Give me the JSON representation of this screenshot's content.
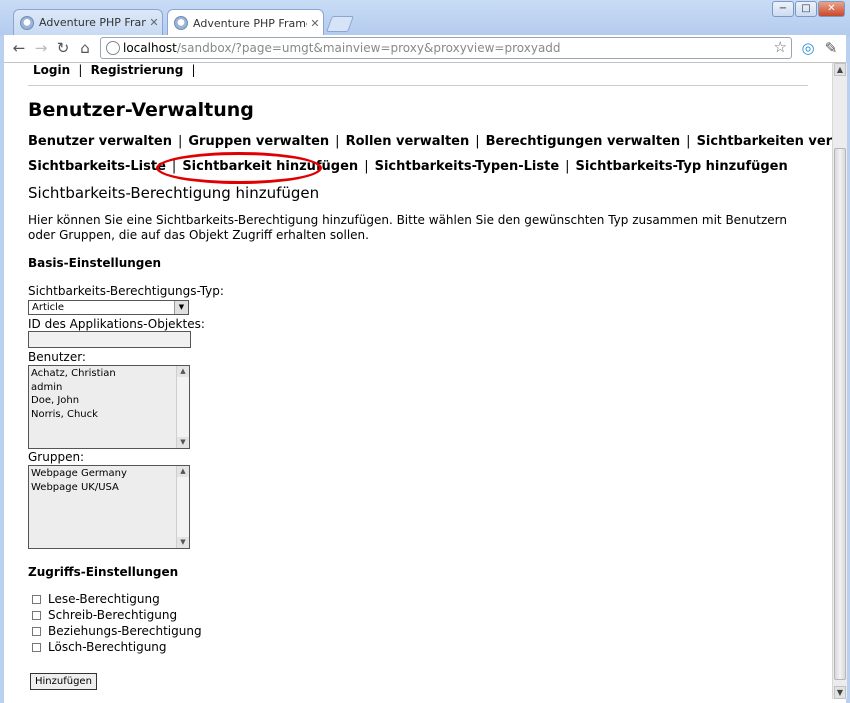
{
  "browser": {
    "tabs": [
      {
        "title": "Adventure PHP Framework sa",
        "active": false
      },
      {
        "title": "Adventure PHP Framework sa",
        "active": true
      }
    ],
    "window_buttons": {
      "minimize": "−",
      "maximize": "□",
      "close": "✕"
    },
    "url_host": "localhost",
    "url_path": "/sandbox/?page=umgt&mainview=proxy&proxyview=proxyadd"
  },
  "topnav": {
    "login": "Login",
    "register": "Registrierung",
    "separator": "|"
  },
  "page": {
    "title": "Benutzer-Verwaltung",
    "menu_row1": [
      "Benutzer verwalten",
      "Gruppen verwalten",
      "Rollen verwalten",
      "Berechtigungen verwalten",
      "Sichtbarkeiten verwalten"
    ],
    "menu_row2": [
      "Sichtbarkeits-Liste",
      "Sichtbarkeit hinzufügen",
      "Sichtbarkeits-Typen-Liste",
      "Sichtbarkeits-Typ hinzufügen"
    ],
    "menu_separator": "|",
    "subtitle": "Sichtbarkeits-Berechtigung hinzufügen",
    "intro": "Hier können Sie eine Sichtbarkeits-Berechtigung hinzufügen. Bitte wählen Sie den gewünschten Typ zusammen mit Benutzern oder Gruppen, die auf das Objekt Zugriff erhalten sollen.",
    "basic_section": "Basis-Einstellungen",
    "type_label": "Sichtbarkeits-Berechtigungs-Typ:",
    "type_value": "Article",
    "object_id_label": "ID des Applikations-Objektes:",
    "object_id_value": "",
    "users_label": "Benutzer:",
    "users": [
      "Achatz, Christian",
      "admin",
      "Doe, John",
      "Norris, Chuck"
    ],
    "groups_label": "Gruppen:",
    "groups": [
      "Webpage Germany",
      "Webpage UK/USA"
    ],
    "access_section": "Zugriffs-Einstellungen",
    "permissions": [
      "Lese-Berechtigung",
      "Schreib-Berechtigung",
      "Beziehungs-Berechtigung",
      "Lösch-Berechtigung"
    ],
    "submit": "Hinzufügen"
  },
  "colors": {
    "highlight_ring": "#e00000"
  }
}
